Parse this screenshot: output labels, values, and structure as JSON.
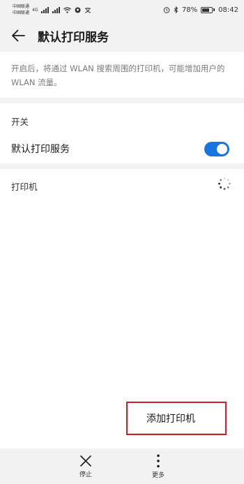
{
  "status_bar": {
    "carrier_1": "中国联通",
    "carrier_2": "中国联通",
    "network_tag": "4G",
    "battery_percent": "78%",
    "battery_level": 0.78,
    "time": "08:42"
  },
  "app_bar": {
    "title": "默认打印服务",
    "back_icon": "arrow-left-icon"
  },
  "description": {
    "text": "开启后，将通过 WLAN 搜索周围的打印机，可能增加用户的 WLAN 流量。"
  },
  "switch_section": {
    "header": "开关",
    "toggle_label": "默认打印服务",
    "toggle_on": true
  },
  "printer_section": {
    "header": "打印机"
  },
  "popup_menu": {
    "items": [
      {
        "label": "添加打印机"
      }
    ]
  },
  "bottom_bar": {
    "stop_label": "停止",
    "stop_icon": "close-icon",
    "more_label": "更多",
    "more_icon": "more-vertical-icon"
  },
  "colors": {
    "accent": "#1875e0",
    "background": "#f2f2f2",
    "highlight_outline": "#c0242c"
  }
}
